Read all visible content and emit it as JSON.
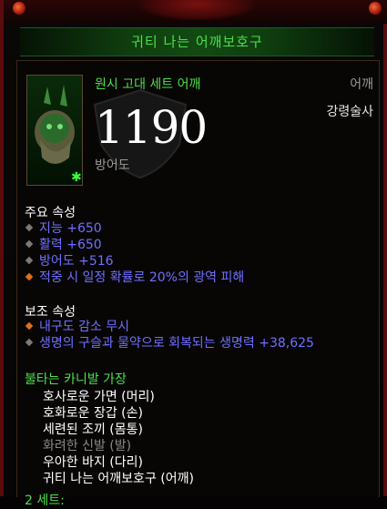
{
  "item": {
    "name": "귀티 나는 어깨보호구",
    "type": "원시 고대 세트 어깨",
    "slot": "어깨",
    "class": "강령술사",
    "armor_value": "1190",
    "armor_label": "방어도"
  },
  "primary": {
    "title": "주요 속성",
    "stats": [
      "지능 +650",
      "활력 +650",
      "방어도 +516",
      "적중 시 일정 확률로 20%의 광역 피해"
    ]
  },
  "secondary": {
    "title": "보조 속성",
    "stats": [
      "내구도 감소 무시",
      "생명의 구슬과 물약으로 회복되는 생명력 +38,625"
    ]
  },
  "set": {
    "title": "불타는 카니발 가장",
    "pieces": [
      {
        "label": "호사로운 가면 (머리)",
        "owned": true
      },
      {
        "label": "호화로운 장갑 (손)",
        "owned": true
      },
      {
        "label": "세련된 조끼 (몸통)",
        "owned": true
      },
      {
        "label": "화려한 신발 (발)",
        "owned": false
      },
      {
        "label": "우아한 바지 (다리)",
        "owned": true
      },
      {
        "label": "귀티 나는 어깨보호구 (어깨)",
        "owned": true
      }
    ],
    "footer": "2 세트:"
  },
  "colors": {
    "set_green": "#4be04b",
    "magic_blue": "#6f6fff",
    "frame_red": "#5a0b0b"
  }
}
